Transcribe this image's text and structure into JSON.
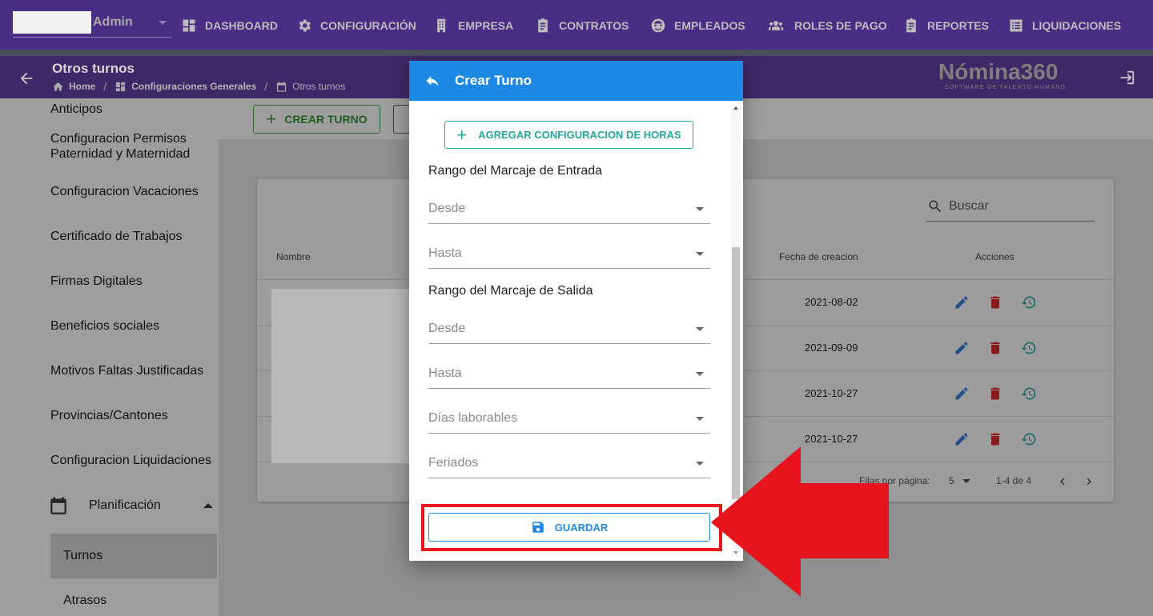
{
  "topnav": {
    "user_label": "Admin",
    "items": [
      {
        "label": "DASHBOARD",
        "icon": "dashboard-icon"
      },
      {
        "label": "CONFIGURACIÓN",
        "icon": "gear-icon"
      },
      {
        "label": "EMPRESA",
        "icon": "building-icon"
      },
      {
        "label": "CONTRATOS",
        "icon": "clipboard-icon"
      },
      {
        "label": "EMPLEADOS",
        "icon": "face-icon"
      },
      {
        "label": "ROLES DE PAGO",
        "icon": "people-icon"
      },
      {
        "label": "REPORTES",
        "icon": "report-icon"
      },
      {
        "label": "LIQUIDACIONES",
        "icon": "list-icon"
      }
    ]
  },
  "header": {
    "title": "Otros turnos",
    "breadcrumb": [
      "Home",
      "Configuraciones Generales",
      "Otros turnos"
    ],
    "logo": "Nómina360",
    "logo_tagline": "SOFTWARE DE TALENTO HUMANO"
  },
  "sidebar": {
    "items": [
      "Anticipos",
      "Configuracion Permisos Paternidad y Maternidad",
      "Configuracion Vacaciones",
      "Certificado de Trabajos",
      "Firmas Digitales",
      "Beneficios sociales",
      "Motivos Faltas Justificadas",
      "Provincias/Cantones",
      "Configuracion Liquidaciones"
    ],
    "group_label": "Planificación",
    "sub_items": [
      "Turnos",
      "Atrasos"
    ]
  },
  "main": {
    "create_button_label": "CREAR TURNO",
    "search_placeholder": "Buscar",
    "columns": [
      "Nombre",
      "Fecha de creacion",
      "Acciones"
    ],
    "rows": [
      {
        "fecha": "2021-08-02"
      },
      {
        "fecha": "2021-09-09"
      },
      {
        "fecha": "2021-10-27"
      },
      {
        "fecha": "2021-10-27"
      }
    ],
    "rows_per_page_label": "Filas por página:",
    "rows_per_page_value": "5",
    "pagination_text": "1-4 de 4"
  },
  "dialog": {
    "title": "Crear Turno",
    "add_hours_label": "AGREGAR CONFIGURACION DE HORAS",
    "entrada_label": "Rango del Marcaje de Entrada",
    "salida_label": "Rango del Marcaje de Salida",
    "fields": {
      "entrada_desde": "Desde",
      "entrada_hasta": "Hasta",
      "salida_desde": "Desde",
      "salida_hasta": "Hasta",
      "dias_laborables": "Días laborables",
      "feriados": "Feriados"
    },
    "save_label": "GUARDAR"
  },
  "colors": {
    "nav_bg": "#4a2d85",
    "primary_blue": "#1e88e5",
    "teal": "#26a69a",
    "annotation_red": "#e8141d",
    "delete_red": "#c62828"
  }
}
